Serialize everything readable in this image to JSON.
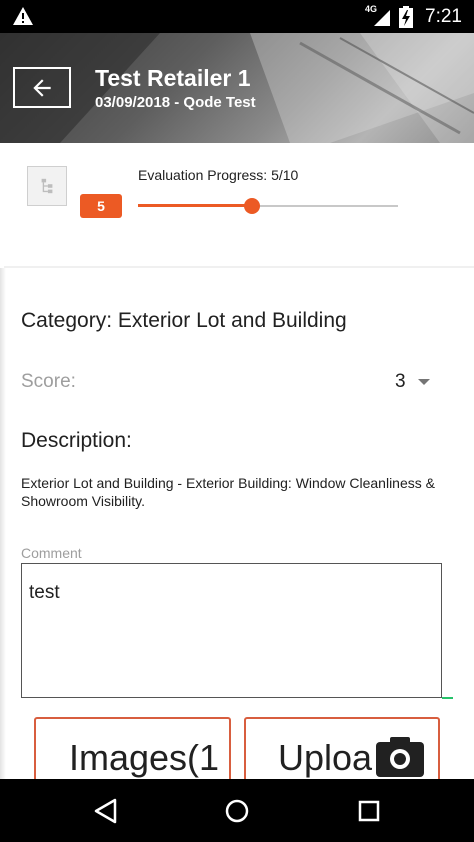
{
  "status_bar": {
    "network_label": "4G",
    "time": "7:21",
    "icons": [
      "warning-icon",
      "signal-icon",
      "battery-charging-icon"
    ]
  },
  "header": {
    "title": "Test Retailer 1",
    "subtitle": "03/09/2018 - Qode Test",
    "back_icon": "arrow-left-icon"
  },
  "progress": {
    "label": "Evaluation Progress: 5/10",
    "badge": "5",
    "current": 5,
    "total": 10,
    "fraction": 0.44,
    "accent_color": "#ec5a24"
  },
  "evaluation": {
    "category": "Category: Exterior Lot and Building",
    "score_label": "Score:",
    "score_value": "3",
    "description_heading": "Description:",
    "description_text": "Exterior Lot and Building - Exterior Building: Window Cleanliness & Showroom Visibility.",
    "comment_label": "Comment",
    "comment_value": "test"
  },
  "actions": {
    "images_label": "Images(1",
    "upload_label": "Uploa",
    "button_border_color": "#d85e3f"
  },
  "nav_bar": {
    "icons": [
      "nav-back-icon",
      "nav-home-icon",
      "nav-recents-icon"
    ]
  }
}
